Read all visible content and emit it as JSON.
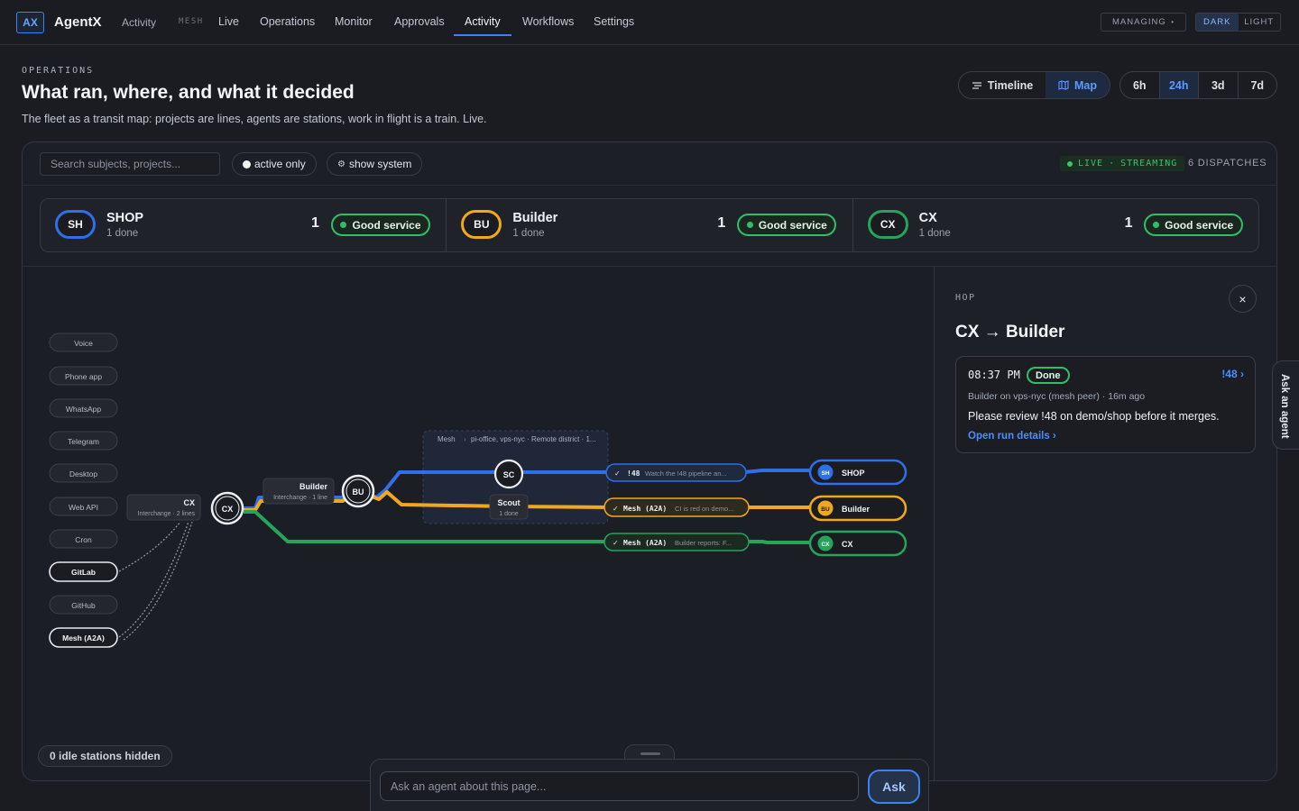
{
  "nav": {
    "logo": "AX",
    "brand": "AgentX",
    "items": [
      {
        "label": "Activity"
      },
      {
        "label": "MESH"
      },
      {
        "label": "Live"
      },
      {
        "label": "Operations"
      },
      {
        "label": "Monitor"
      },
      {
        "label": "Approvals"
      },
      {
        "label": "Activity"
      },
      {
        "label": "Workflows"
      },
      {
        "label": "Settings"
      }
    ],
    "managing": "MANAGING",
    "theme": {
      "dark": "DARK",
      "light": "LIGHT"
    }
  },
  "header": {
    "eyebrow": "OPERATIONS",
    "title": "What ran, where, and what it decided",
    "subtitle": "The fleet as a transit map: projects are lines, agents are stations, work in flight is a train. Live."
  },
  "view_switch": {
    "timeline": "Timeline",
    "map": "Map",
    "active": "Map"
  },
  "ranges": [
    {
      "label": "6h"
    },
    {
      "label": "24h"
    },
    {
      "label": "3d"
    },
    {
      "label": "7d"
    }
  ],
  "range_active": "24h",
  "toolbar": {
    "search_placeholder": "Search subjects, projects...",
    "active_only": "active only",
    "show_system": "show system",
    "live": "LIVE",
    "streaming": "STREAMING",
    "dispatches": "6 DISPATCHES"
  },
  "lines": [
    {
      "code": "SH",
      "name": "SHOP",
      "sub": "1 done",
      "count": "1",
      "service": "Good service",
      "color": "#2f6fe8"
    },
    {
      "code": "BU",
      "name": "Builder",
      "sub": "1 done",
      "count": "1",
      "service": "Good service",
      "color": "#f2a81d"
    },
    {
      "code": "CX",
      "name": "CX",
      "sub": "1 done",
      "count": "1",
      "service": "Good service",
      "color": "#25a55a"
    }
  ],
  "map": {
    "sources": [
      {
        "label": "Voice"
      },
      {
        "label": "Phone app"
      },
      {
        "label": "WhatsApp"
      },
      {
        "label": "Telegram"
      },
      {
        "label": "Desktop"
      },
      {
        "label": "Web API"
      },
      {
        "label": "Cron"
      },
      {
        "label": "GitLab"
      },
      {
        "label": "GitHub"
      },
      {
        "label": "Mesh (A2A)"
      }
    ],
    "interchange_cx": {
      "name": "CX",
      "sub": "Interchange · 2 lines",
      "badge": "CX"
    },
    "builder_station": {
      "name": "Builder",
      "sub": "Interchange · 1 line",
      "badge": "BU"
    },
    "mesh_zone": {
      "label": "Mesh",
      "hosts": "pi-office, vps-nyc · Remote district · 1..."
    },
    "scout": {
      "badge": "SC",
      "name": "Scout",
      "sub": "1 done"
    },
    "trains": [
      {
        "tag": "!48",
        "text": "Watch the !48 pipeline an..."
      },
      {
        "tag": "Mesh (A2A)",
        "text": "CI is red on demo..."
      },
      {
        "tag": "Mesh (A2A)",
        "text": "Builder reports: F..."
      }
    ],
    "terminals": [
      {
        "code": "SH",
        "name": "SHOP"
      },
      {
        "code": "BU",
        "name": "Builder"
      },
      {
        "code": "CX",
        "name": "CX"
      }
    ],
    "idle_hidden": "0 idle stations hidden"
  },
  "detail": {
    "label": "HOP",
    "close": "×",
    "title": "CX → Builder",
    "time": "08:37 PM",
    "status": "Done",
    "ref": "!48 ›",
    "meta": "Builder on vps-nyc (mesh peer) · 16m ago",
    "message": "Please review !48 on demo/shop before it merges.",
    "link": "Open run details ›"
  },
  "ask": {
    "tab": "Ask an agent",
    "placeholder": "Ask an agent about this page...",
    "button": "Ask"
  },
  "colors": {
    "blue": "#2f6fe8",
    "amber": "#f2a81d",
    "green": "#25a55a",
    "accent": "#3b82f6"
  }
}
